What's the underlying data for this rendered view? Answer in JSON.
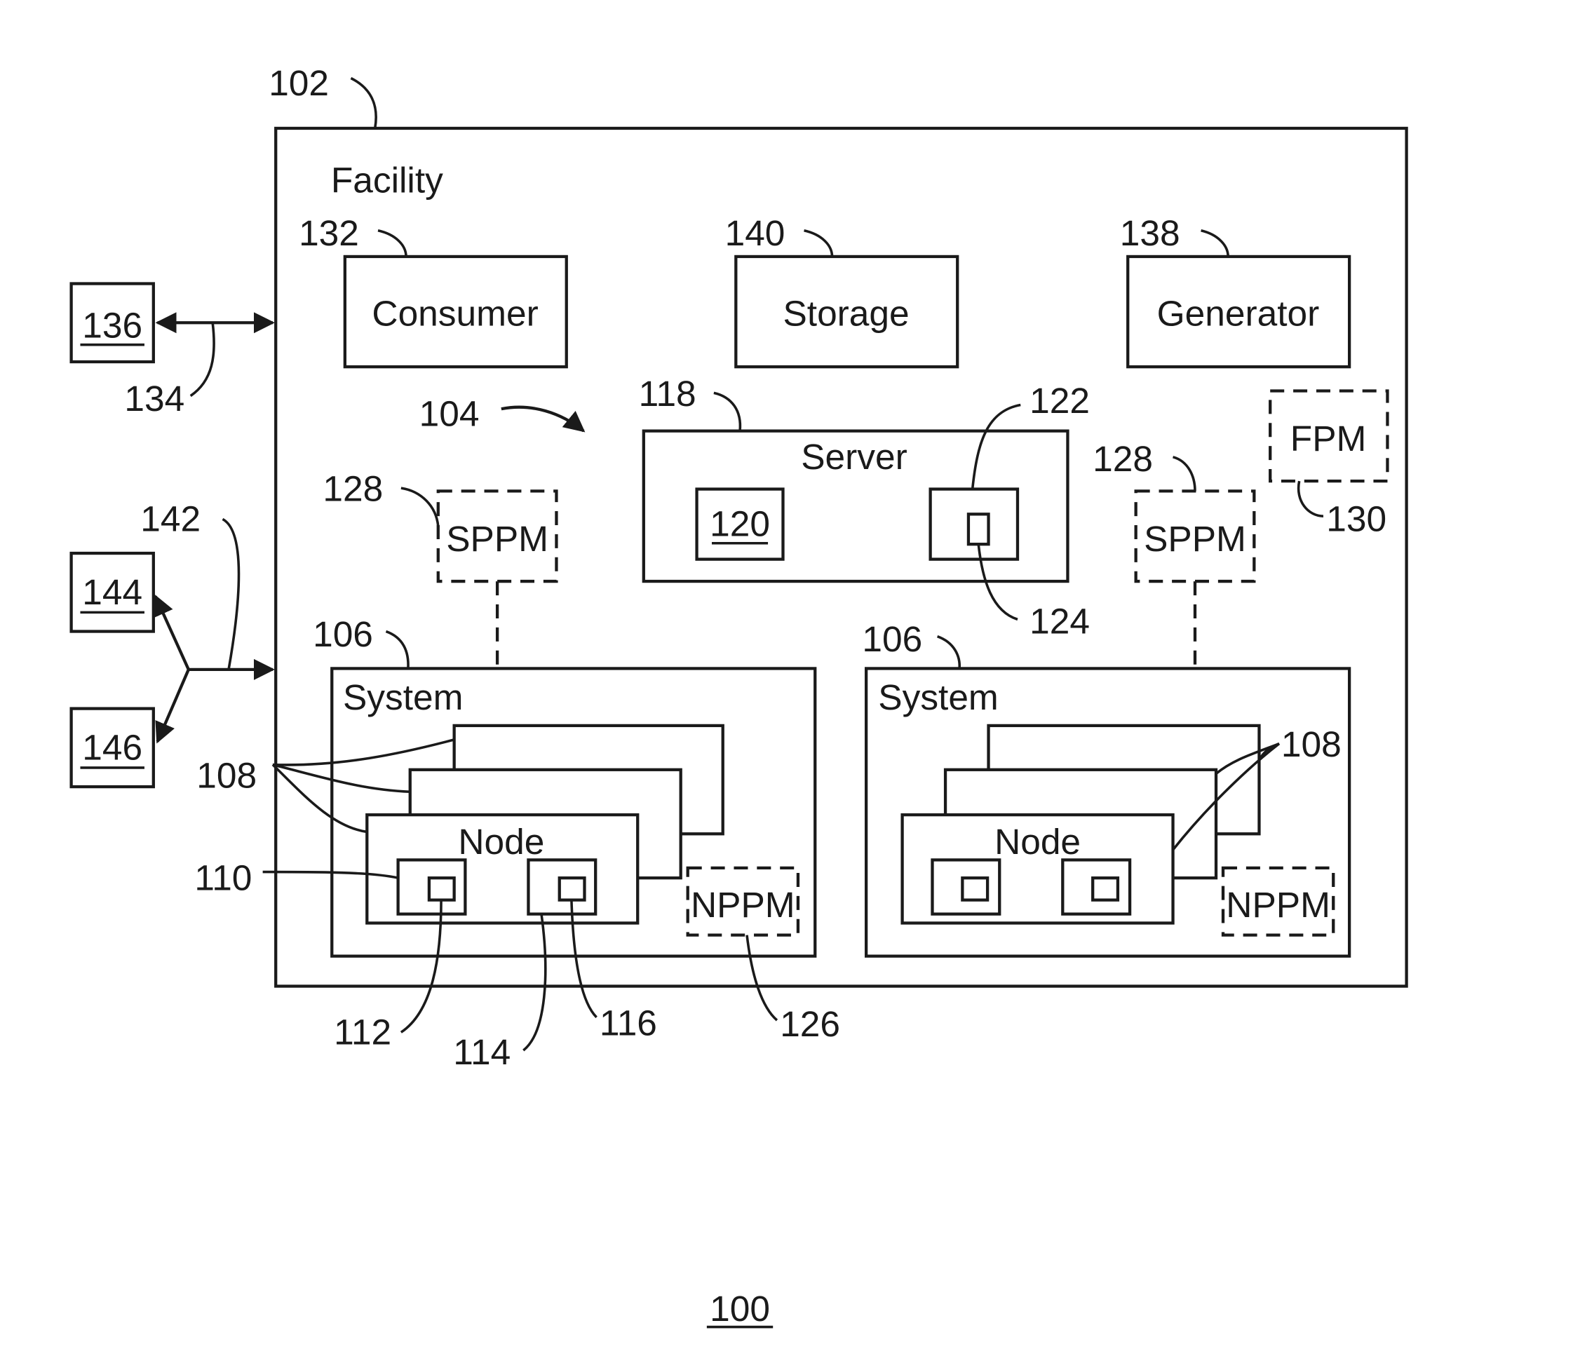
{
  "figure": {
    "number": "100",
    "facility": {
      "ref": "102",
      "label": "Facility"
    },
    "external": [
      {
        "id": "136",
        "link_ref": "134"
      },
      {
        "id": "144",
        "link_ref": "142"
      },
      {
        "id": "146",
        "link_ref": "142"
      }
    ],
    "consumer": {
      "ref": "132",
      "label": "Consumer"
    },
    "storage": {
      "ref": "140",
      "label": "Storage"
    },
    "generator": {
      "ref": "138",
      "label": "Generator"
    },
    "network_ref": "104",
    "server": {
      "ref": "118",
      "label": "Server",
      "component_a": "120",
      "component_b_ref": "122",
      "component_b_inner_ref": "124"
    },
    "fpm": {
      "ref": "130",
      "label": "FPM"
    },
    "sppm_left": {
      "ref": "128",
      "label": "SPPM"
    },
    "sppm_right": {
      "ref": "128",
      "label": "SPPM"
    },
    "system_left": {
      "ref": "106",
      "label": "System",
      "nodes_ref": "108",
      "node_label": "Node",
      "node_component_a_ref": "110",
      "node_component_a_inner_ref": "112",
      "node_component_b_ref": "114",
      "node_component_b_inner_ref": "116",
      "nppm": {
        "ref": "126",
        "label": "NPPM"
      }
    },
    "system_right": {
      "ref": "106",
      "label": "System",
      "nodes_ref": "108",
      "node_label": "Node",
      "nppm": {
        "label": "NPPM"
      }
    }
  }
}
